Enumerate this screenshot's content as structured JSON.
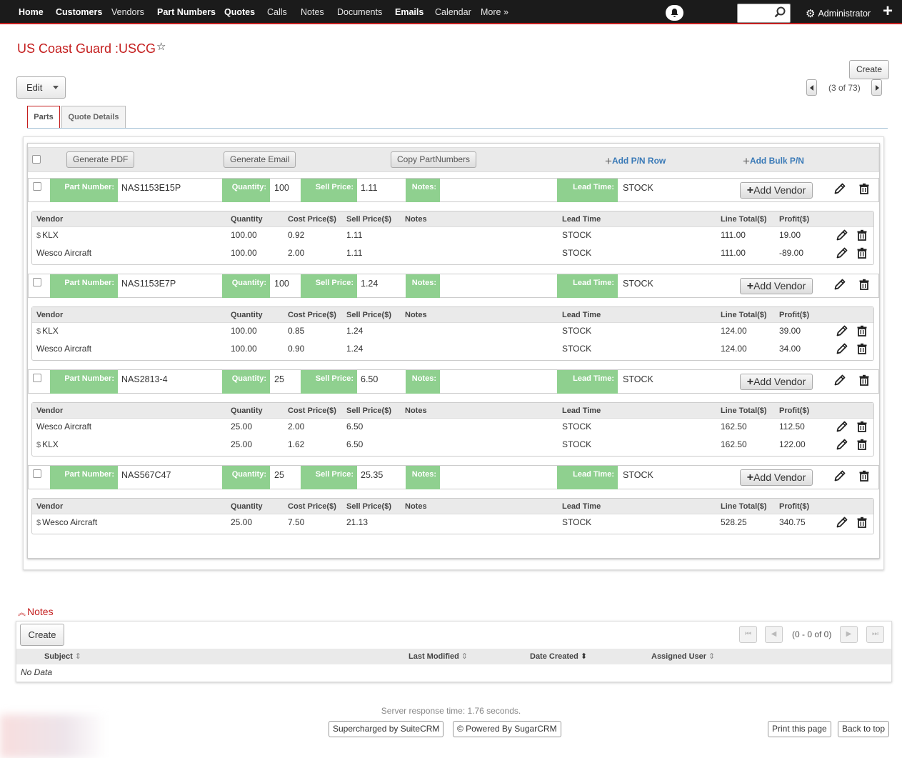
{
  "nav": {
    "items": [
      "Home",
      "Customers",
      "Vendors",
      "Part Numbers",
      "Quotes",
      "Calls",
      "Notes",
      "Documents",
      "Emails",
      "Calendar",
      "More »"
    ],
    "user": "Administrator"
  },
  "record": {
    "title": "US Coast Guard :USCG",
    "edit_label": "Edit",
    "create_label": "Create",
    "pagination": "(3 of 73)"
  },
  "tabs": [
    "Parts",
    "Quote Details"
  ],
  "toolbar": {
    "generate_pdf": "Generate PDF",
    "generate_email": "Generate Email",
    "copy_partnumbers": "Copy PartNumbers",
    "add_pn_row": "Add P/N Row",
    "add_bulk_pn": "Add Bulk P/N"
  },
  "part_labels": {
    "part_number": "Part Number:",
    "quantity": "Quantity:",
    "sell_price": "Sell Price:",
    "notes": "Notes:",
    "lead_time": "Lead Time:",
    "add_vendor": "Add Vendor"
  },
  "vendor_headers": [
    "Vendor",
    "Quantity",
    "Cost Price($)",
    "Sell Price($)",
    "Notes",
    "Lead Time",
    "Line Total($)",
    "Profit($)"
  ],
  "parts": [
    {
      "part_number": "NAS1153E15P",
      "quantity": "100",
      "sell_price": "1.11",
      "notes": "",
      "lead_time": "STOCK",
      "vendors": [
        {
          "vendor": "KLX",
          "marked": true,
          "quantity": "100.00",
          "cost": "0.92",
          "sell": "1.11",
          "notes": "",
          "lead_time": "STOCK",
          "line_total": "111.00",
          "profit": "19.00"
        },
        {
          "vendor": "Wesco Aircraft",
          "marked": false,
          "quantity": "100.00",
          "cost": "2.00",
          "sell": "1.11",
          "notes": "",
          "lead_time": "STOCK",
          "line_total": "111.00",
          "profit": "-89.00"
        }
      ]
    },
    {
      "part_number": "NAS1153E7P",
      "quantity": "100",
      "sell_price": "1.24",
      "notes": "",
      "lead_time": "STOCK",
      "vendors": [
        {
          "vendor": "KLX",
          "marked": true,
          "quantity": "100.00",
          "cost": "0.85",
          "sell": "1.24",
          "notes": "",
          "lead_time": "STOCK",
          "line_total": "124.00",
          "profit": "39.00"
        },
        {
          "vendor": "Wesco Aircraft",
          "marked": false,
          "quantity": "100.00",
          "cost": "0.90",
          "sell": "1.24",
          "notes": "",
          "lead_time": "STOCK",
          "line_total": "124.00",
          "profit": "34.00"
        }
      ]
    },
    {
      "part_number": "NAS2813-4",
      "quantity": "25",
      "sell_price": "6.50",
      "notes": "",
      "lead_time": "STOCK",
      "vendors": [
        {
          "vendor": "Wesco Aircraft",
          "marked": false,
          "quantity": "25.00",
          "cost": "2.00",
          "sell": "6.50",
          "notes": "",
          "lead_time": "STOCK",
          "line_total": "162.50",
          "profit": "112.50"
        },
        {
          "vendor": "KLX",
          "marked": true,
          "quantity": "25.00",
          "cost": "1.62",
          "sell": "6.50",
          "notes": "",
          "lead_time": "STOCK",
          "line_total": "162.50",
          "profit": "122.00"
        }
      ]
    },
    {
      "part_number": "NAS567C47",
      "quantity": "25",
      "sell_price": "25.35",
      "notes": "",
      "lead_time": "STOCK",
      "vendors": [
        {
          "vendor": "Wesco Aircraft",
          "marked": true,
          "quantity": "25.00",
          "cost": "7.50",
          "sell": "21.13",
          "notes": "",
          "lead_time": "STOCK",
          "line_total": "528.25",
          "profit": "340.75"
        }
      ]
    }
  ],
  "notes_panel": {
    "title": "Notes",
    "create_label": "Create",
    "pagination": "(0 - 0 of 0)",
    "columns": [
      "Subject",
      "Last Modified",
      "Date Created",
      "Assigned User"
    ],
    "empty": "No Data"
  },
  "footer": {
    "server_time": "Server response time: 1.76 seconds.",
    "suitecrm": "Supercharged by SuiteCRM",
    "sugarcrm": "© Powered By SugarCRM",
    "print": "Print this page",
    "back_to_top": "Back to top"
  },
  "colors": {
    "accent": "#c41e1e",
    "label_green": "#8fd08f",
    "link_blue": "#3a7ab7",
    "nav_bg": "#1b1b1b"
  }
}
